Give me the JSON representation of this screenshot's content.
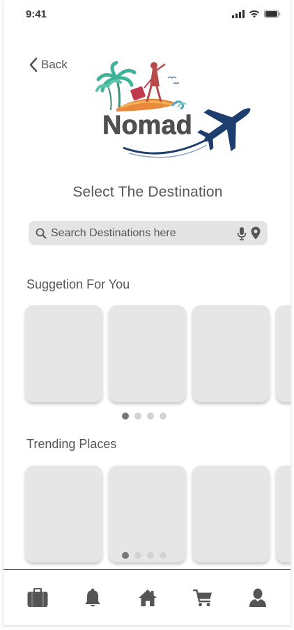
{
  "status_bar": {
    "time": "9:41"
  },
  "header": {
    "back_label": "Back",
    "logo_text": "Nomad"
  },
  "page": {
    "title": "Select The Destination"
  },
  "search": {
    "placeholder": "Search Destinations here"
  },
  "sections": {
    "suggestions": {
      "title": "Suggetion For You"
    },
    "trending": {
      "title": "Trending Places"
    }
  },
  "tabbar": {
    "items": [
      {
        "icon": "briefcase-icon"
      },
      {
        "icon": "bell-icon"
      },
      {
        "icon": "home-icon"
      },
      {
        "icon": "cart-icon"
      },
      {
        "icon": "user-icon"
      }
    ]
  },
  "colors": {
    "card": "#e6e6e6",
    "accent_navy": "#1e3f6e",
    "icon_gray": "#555555"
  }
}
